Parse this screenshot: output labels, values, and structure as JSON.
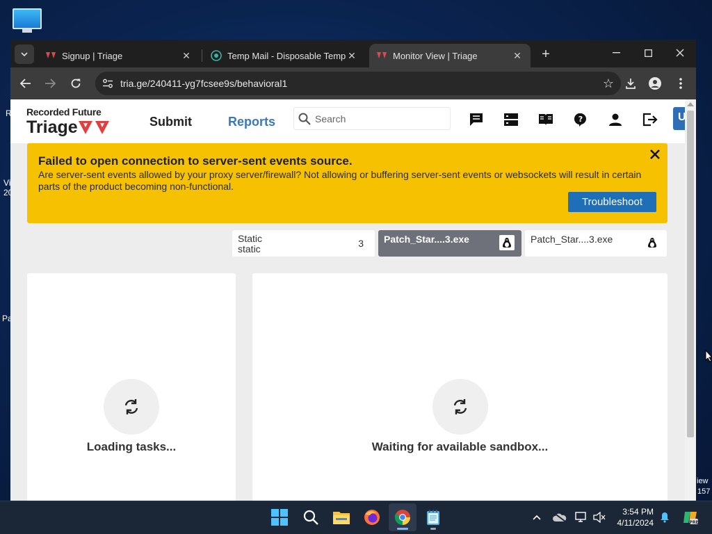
{
  "browser": {
    "tabs": [
      {
        "title": "Signup | Triage",
        "favicon": "triage-icon"
      },
      {
        "title": "Temp Mail - Disposable Tempo",
        "favicon": "tempmail-icon"
      },
      {
        "title": "Monitor View | Triage",
        "favicon": "triage-icon",
        "active": true
      }
    ],
    "new_tab": "+",
    "url": "tria.ge/240411-yg7fcsee9s/behavioral1"
  },
  "header": {
    "logo_top": "Recorded Future",
    "logo_bottom": "Triage",
    "nav_submit": "Submit",
    "nav_reports": "Reports",
    "search_placeholder": "Search",
    "user_initial": "U"
  },
  "alert": {
    "title": "Failed to open connection to server-sent events source.",
    "message": "Are server-sent events allowed by your proxy server/firewall? Not allowing or buffering server-sent events or websockets will result in certain parts of the product becoming non-functional.",
    "button": "Troubleshoot"
  },
  "sample_tabs": [
    {
      "line1": "Static",
      "line2": "static",
      "count": "3"
    },
    {
      "name": "Patch_Star....3.exe",
      "os_icon": "linux-icon",
      "active": true
    },
    {
      "name": "Patch_Star....3.exe",
      "os_icon": "linux-icon"
    }
  ],
  "panels": {
    "left_text": "Loading tasks...",
    "right_text": "Waiting for available sandbox..."
  },
  "desktop_edge": {
    "left1": "R",
    "left2": "Vi",
    "left3": "20",
    "left4": "Pa",
    "right1": "iew",
    "right2": "157"
  },
  "taskbar": {
    "time": "3:54 PM",
    "date": "4/11/2024",
    "apps": [
      "windows-start-icon",
      "search-icon",
      "file-explorer-icon",
      "firefox-icon",
      "chrome-icon",
      "notepad-icon"
    ]
  },
  "colors": {
    "alert": "#f6c100",
    "accent_blue": "#1f6fb8",
    "brand_red": "#d93b3b"
  }
}
